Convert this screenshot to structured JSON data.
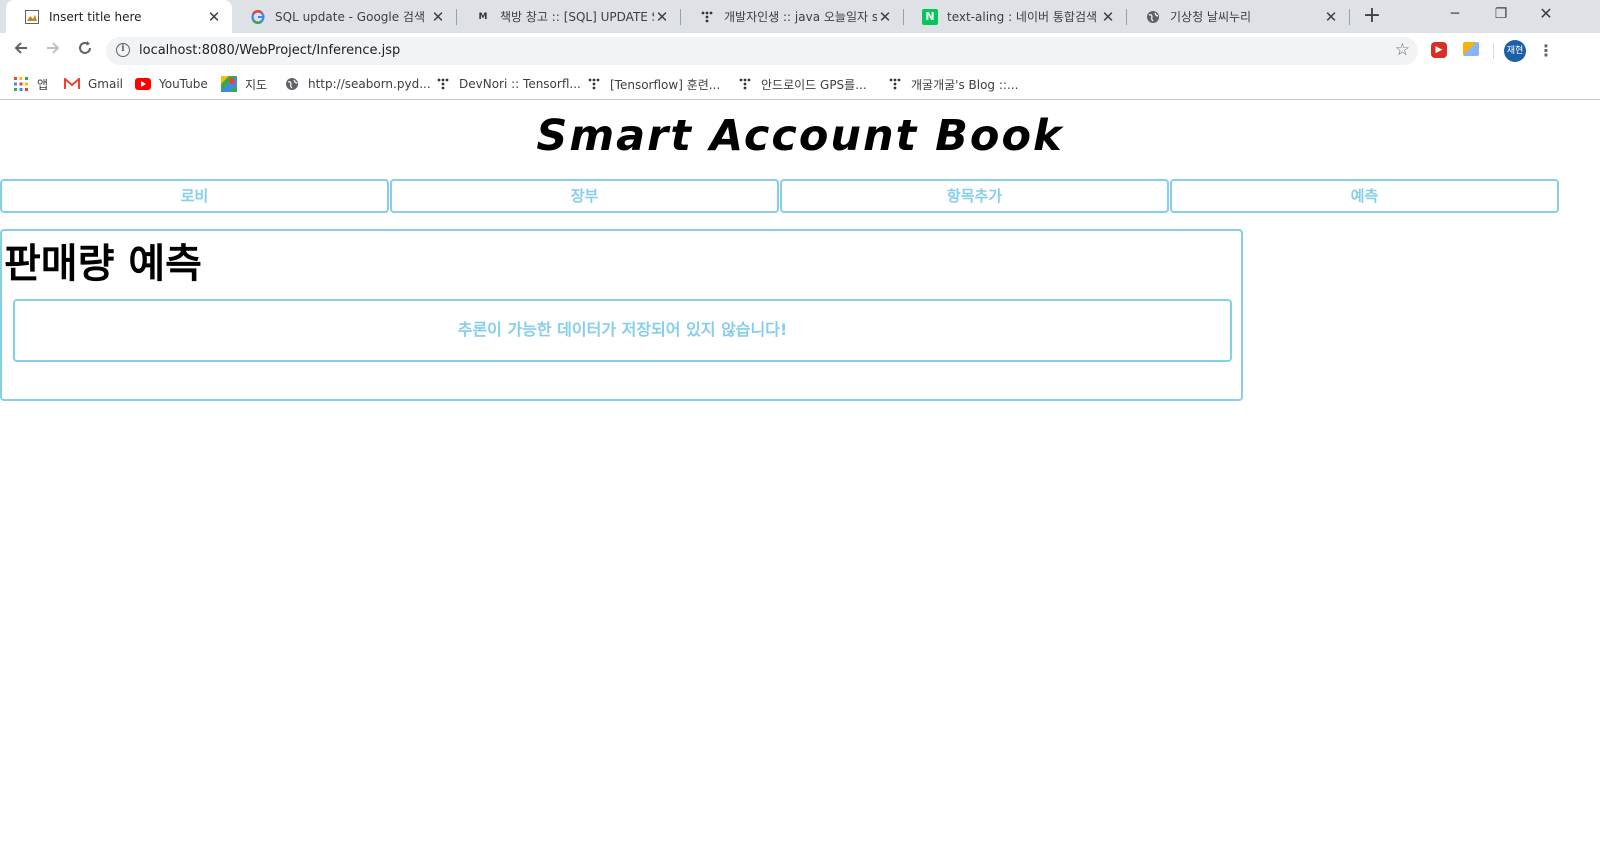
{
  "browser": {
    "tabs": [
      {
        "label": "Insert title here",
        "icon": "page-favicon",
        "active": true
      },
      {
        "label": "SQL update - Google 검색",
        "icon": "google-icon",
        "active": false
      },
      {
        "label": "책방 창고 :: [SQL] UPDATE SE",
        "icon": "blog-icon",
        "active": false
      },
      {
        "label": "개발자인생 :: java 오늘일자 st",
        "icon": "tistory-icon",
        "active": false
      },
      {
        "label": "text-aling : 네이버 통합검색",
        "icon": "naver-icon",
        "active": false
      },
      {
        "label": "기상청 날씨누리",
        "icon": "globe-icon",
        "active": false
      }
    ],
    "address": "localhost:8080/WebProject/Inference.jsp",
    "profile_initials": "재현",
    "bookmarks": [
      {
        "label": "앱",
        "icon": "apps-grid-icon"
      },
      {
        "label": "Gmail",
        "icon": "gmail-icon"
      },
      {
        "label": "YouTube",
        "icon": "youtube-icon"
      },
      {
        "label": "지도",
        "icon": "maps-icon"
      },
      {
        "label": "http://seaborn.pyd...",
        "icon": "globe-icon"
      },
      {
        "label": "DevNori :: Tensorfl...",
        "icon": "tistory-icon"
      },
      {
        "label": "[Tensorflow] 훈련...",
        "icon": "tistory-icon"
      },
      {
        "label": "안드로이드 GPS를...",
        "icon": "tistory-icon"
      },
      {
        "label": "개굴개굴's Blog ::...",
        "icon": "tistory-icon"
      }
    ]
  },
  "site": {
    "title": "Smart Account Book",
    "nav": [
      {
        "label": "로비"
      },
      {
        "label": "장부"
      },
      {
        "label": "항목추가"
      },
      {
        "label": "예측"
      }
    ],
    "section_title": "판매량 예측",
    "message": "추론이 가능한 데이터가 저장되어 있지 않습니다!"
  },
  "colors": {
    "accent": "#87ceeb",
    "tabstrip": "#dee1e6"
  }
}
